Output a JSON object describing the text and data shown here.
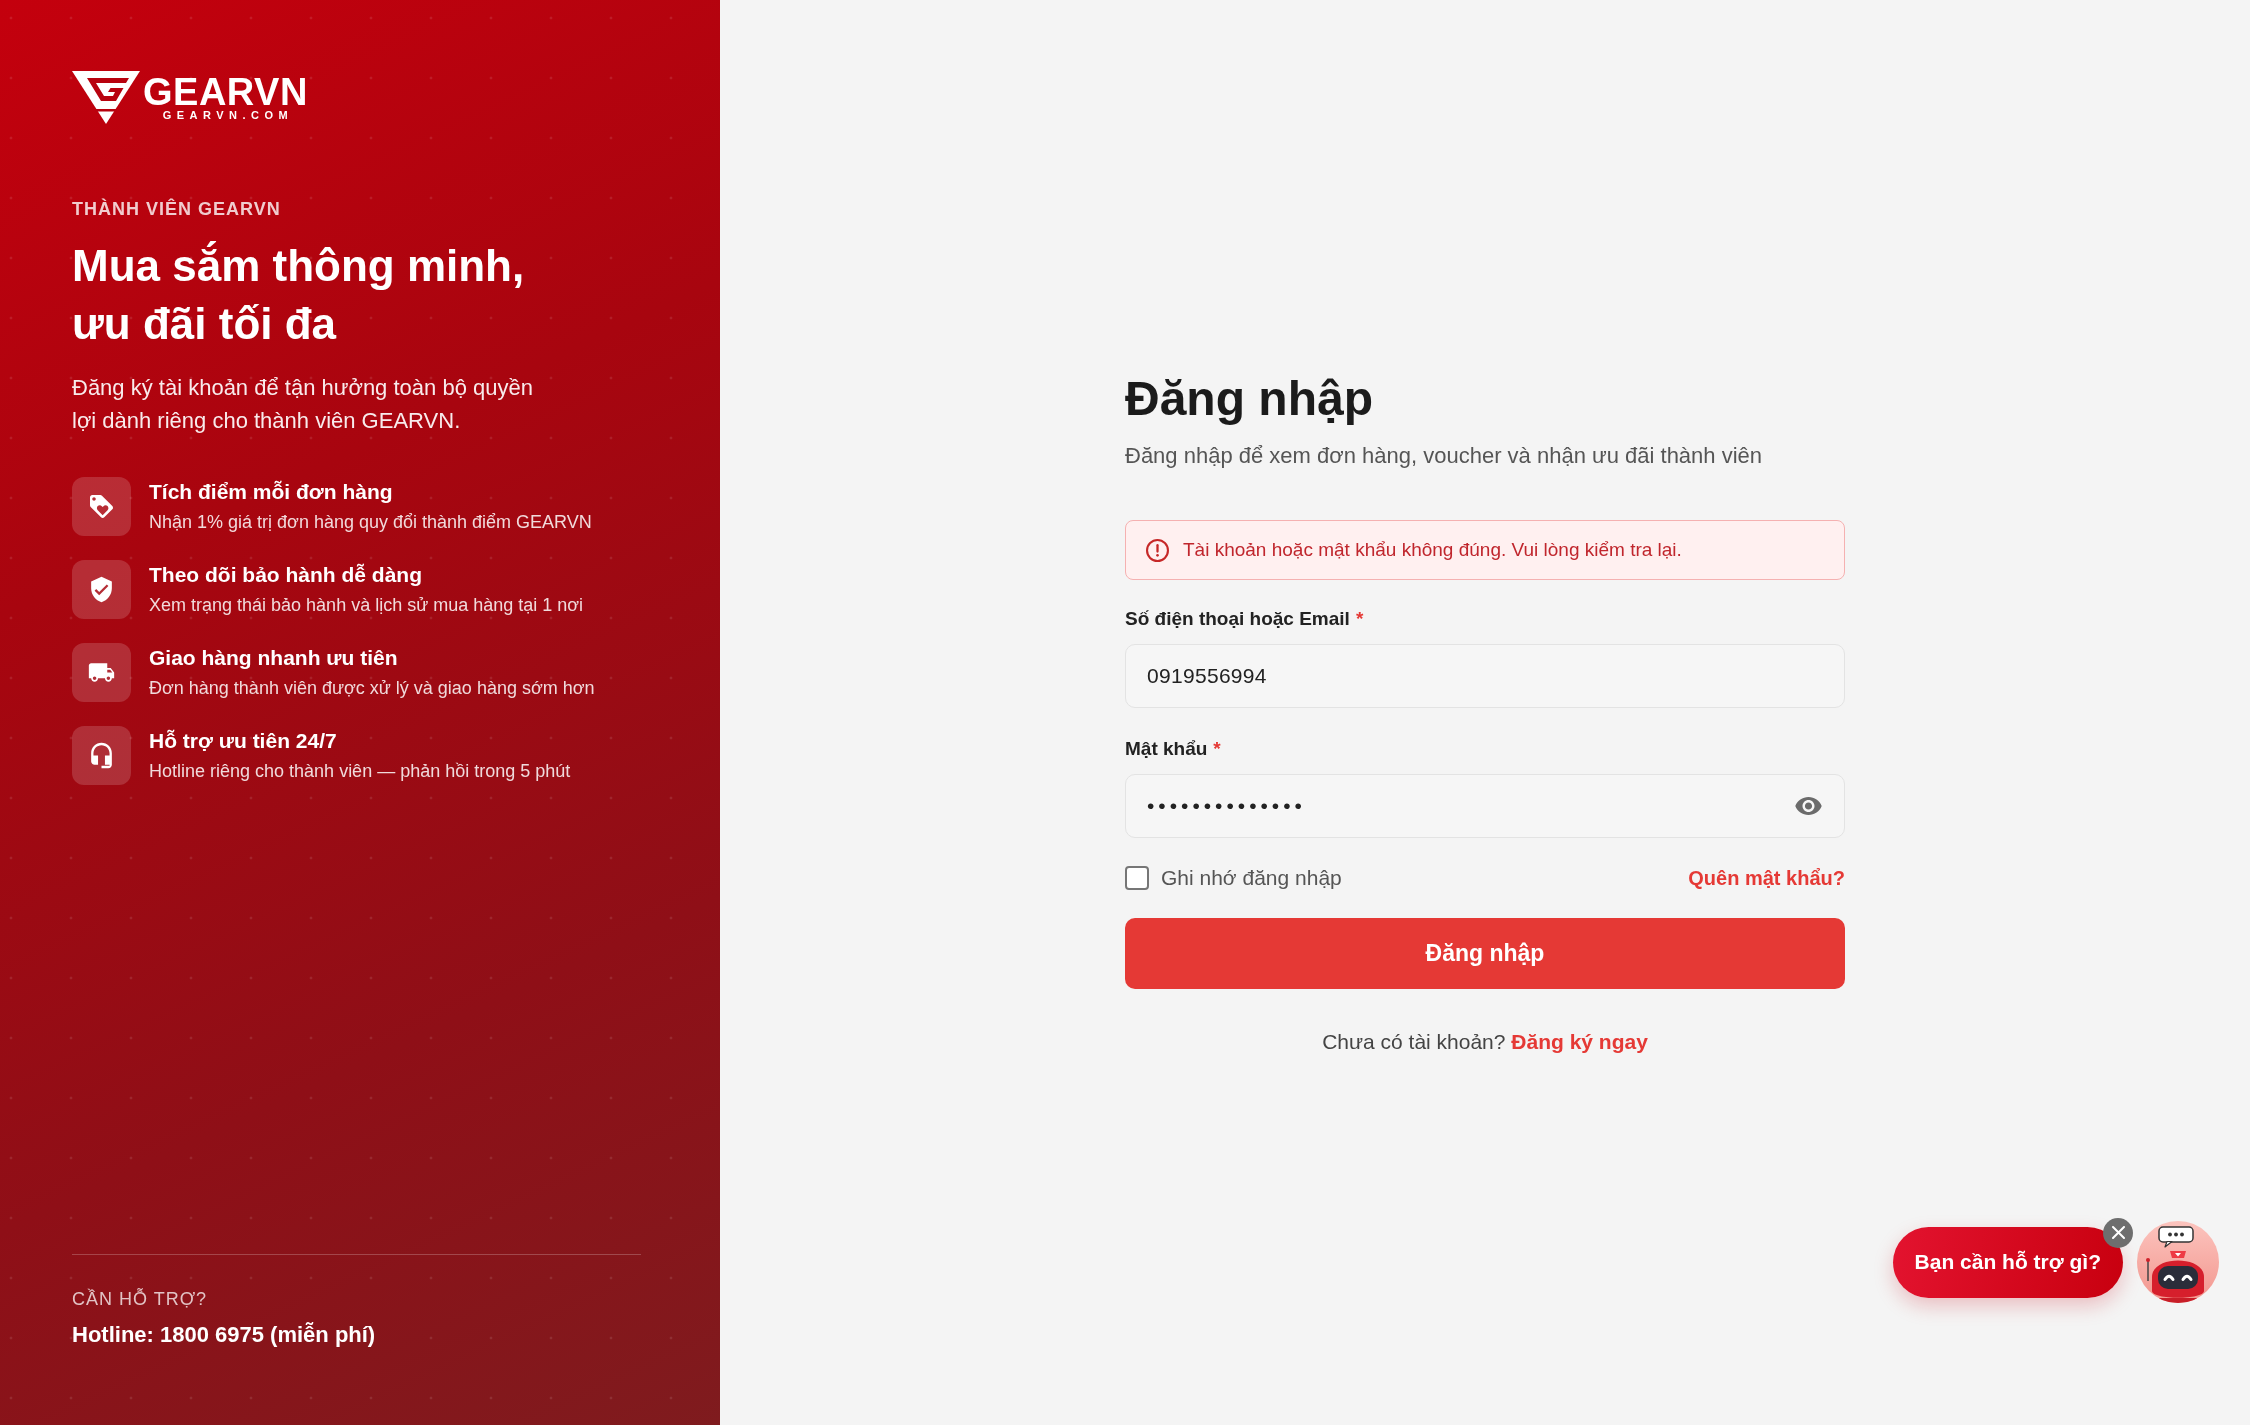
{
  "brand": {
    "name": "GEARVN",
    "domain": "GEARVN.COM"
  },
  "promo": {
    "eyebrow": "THÀNH VIÊN GEARVN",
    "headline": "Mua sắm thông minh, ưu đãi tối đa",
    "description": "Đăng ký tài khoản để tận hưởng toàn bộ quyền lợi dành riêng cho thành viên GEARVN.",
    "features": [
      {
        "kind": "points",
        "title": "Tích điểm mỗi đơn hàng",
        "description": "Nhận 1% giá trị đơn hàng quy đổi thành điểm GEARVN"
      },
      {
        "kind": "warranty",
        "title": "Theo dõi bảo hành dễ dàng",
        "description": "Xem trạng thái bảo hành và lịch sử mua hàng tại 1 nơi"
      },
      {
        "kind": "delivery",
        "title": "Giao hàng nhanh ưu tiên",
        "description": "Đơn hàng thành viên được xử lý và giao hàng sớm hơn"
      },
      {
        "kind": "support",
        "title": "Hỗ trợ ưu tiên 24/7",
        "description": "Hotline riêng cho thành viên — phản hồi trong 5 phút"
      }
    ]
  },
  "support": {
    "label": "CẦN HỖ TRỢ?",
    "hotline": "Hotline: 1800 6975 (miễn phí)"
  },
  "login": {
    "title": "Đăng nhập",
    "subtitle": "Đăng nhập để xem đơn hàng, voucher và nhận ưu đãi thành viên",
    "error": "Tài khoản hoặc mật khẩu không đúng. Vui lòng kiểm tra lại.",
    "fields": [
      {
        "kind": "text",
        "label": "Số điện thoại hoặc Email",
        "required_mark": "*",
        "value": "0919556994"
      },
      {
        "kind": "password",
        "label": "Mật khẩu",
        "required_mark": "*",
        "value": "••••••••••••••"
      }
    ],
    "remember": {
      "label": "Ghi nhớ đăng nhập",
      "checked": false
    },
    "forgot_link": "Quên mật khẩu?",
    "submit": "Đăng nhập",
    "signup_prompt": "Chưa có tài khoản?",
    "signup_link": "Đăng ký ngay"
  },
  "chat_widget": {
    "prompt": "Bạn cần hỗ trợ gì?"
  }
}
